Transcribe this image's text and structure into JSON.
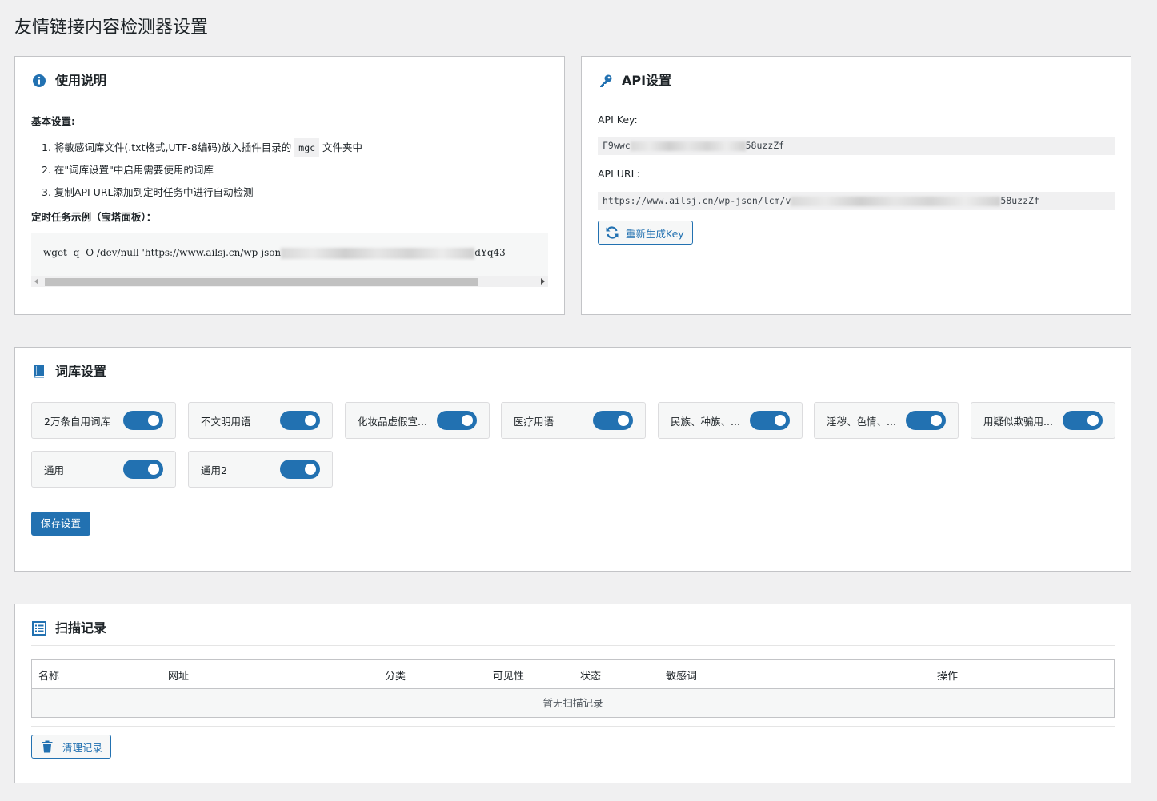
{
  "page": {
    "title": "友情链接内容检测器设置"
  },
  "usage": {
    "title": "使用说明",
    "basic_heading": "基本设置:",
    "steps": [
      {
        "num": "1.",
        "text_before": "将敏感词库文件(.txt格式,UTF-8编码)放入插件目录的",
        "code": "mgc",
        "text_after": "文件夹中"
      },
      {
        "num": "2.",
        "text": "在\"词库设置\"中启用需要使用的词库"
      },
      {
        "num": "3.",
        "text": "复制API URL添加到定时任务中进行自动检测"
      }
    ],
    "cron_heading": "定时任务示例（宝塔面板）：",
    "cron_command_prefix": "wget -q -O /dev/null 'https://www.ailsj.cn/wp-json",
    "cron_command_suffix": "dYq43"
  },
  "api": {
    "title": "API设置",
    "key_label": "API Key:",
    "key_prefix": "F9wwc",
    "key_suffix": "58uzzZf",
    "url_label": "API URL:",
    "url_prefix": "https://www.ailsj.cn/wp-json/lcm/v",
    "url_suffix": "58uzzZf",
    "regen_label": "重新生成Key"
  },
  "lexicon": {
    "title": "词库设置",
    "items": [
      {
        "label": "2万条自用词库",
        "enabled": true
      },
      {
        "label": "不文明用语",
        "enabled": true
      },
      {
        "label": "化妆品虚假宣...",
        "enabled": true
      },
      {
        "label": "医疗用语",
        "enabled": true
      },
      {
        "label": "民族、种族、...",
        "enabled": true
      },
      {
        "label": "淫秽、色情、...",
        "enabled": true
      },
      {
        "label": "用疑似欺骗用...",
        "enabled": true
      },
      {
        "label": "通用",
        "enabled": true
      },
      {
        "label": "通用2",
        "enabled": true
      }
    ],
    "save_label": "保存设置"
  },
  "records": {
    "title": "扫描记录",
    "columns": [
      "名称",
      "网址",
      "分类",
      "可见性",
      "状态",
      "敏感词",
      "操作"
    ],
    "empty_text": "暂无扫描记录",
    "clear_label": "清理记录"
  },
  "colors": {
    "accent": "#2271b1",
    "background": "#f0f0f1"
  }
}
